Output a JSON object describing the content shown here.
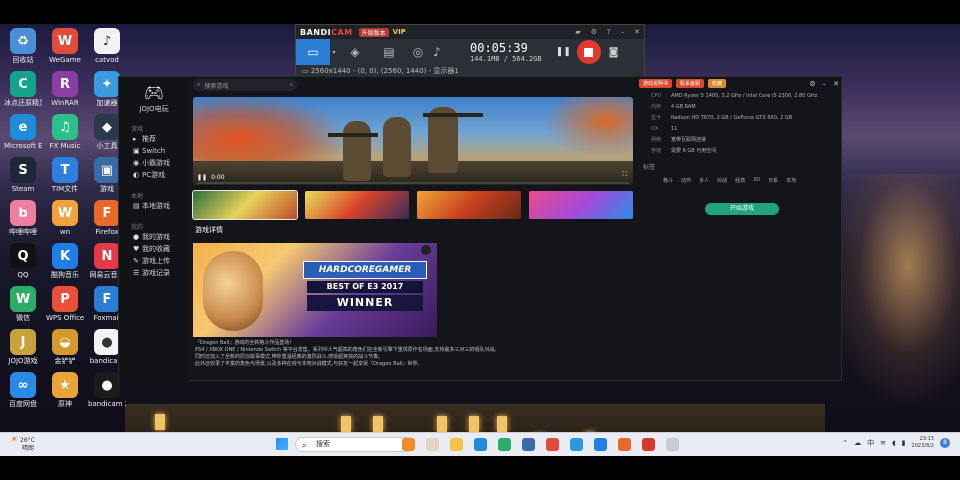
{
  "desktop": {
    "icons": [
      {
        "label": "回收站",
        "color": "#4b8fd8",
        "glyph": "♻"
      },
      {
        "label": "WeGame",
        "color": "#e24b3a",
        "glyph": "W"
      },
      {
        "label": "catvod",
        "color": "#f2f2f2",
        "glyph": "♪"
      },
      {
        "label": "冰点还原精灵",
        "color": "#13a58b",
        "glyph": "C"
      },
      {
        "label": "WinRAR",
        "color": "#8a3fa0",
        "glyph": "R"
      },
      {
        "label": "加速器",
        "color": "#3a9be0",
        "glyph": "✦"
      },
      {
        "label": "Microsoft Edge",
        "color": "#1e8cd8",
        "glyph": "e"
      },
      {
        "label": "FX Music",
        "color": "#2bbf8a",
        "glyph": "♫"
      },
      {
        "label": "小工具",
        "color": "#2a3a4a",
        "glyph": "◆"
      },
      {
        "label": "Steam",
        "color": "#1b2838",
        "glyph": "S"
      },
      {
        "label": "TIM文件",
        "color": "#2e7fe0",
        "glyph": "T"
      },
      {
        "label": "游戏",
        "color": "#3a6aa8",
        "glyph": "▣"
      },
      {
        "label": "哔哩哔哩",
        "color": "#f07ca2",
        "glyph": "b"
      },
      {
        "label": "wn",
        "color": "#f2a23a",
        "glyph": "W"
      },
      {
        "label": "Firefox",
        "color": "#e86a2a",
        "glyph": "F"
      },
      {
        "label": "QQ",
        "color": "#111111",
        "glyph": "Q"
      },
      {
        "label": "酷狗音乐",
        "color": "#1f7ee8",
        "glyph": "K"
      },
      {
        "label": "网易云音乐",
        "color": "#e43a4a",
        "glyph": "N"
      },
      {
        "label": "微信",
        "color": "#2aae67",
        "glyph": "W"
      },
      {
        "label": "WPS Office",
        "color": "#e8503a",
        "glyph": "P"
      },
      {
        "label": "Foxmail",
        "color": "#2a7fd4",
        "glyph": "F"
      },
      {
        "label": "JOJO游戏",
        "color": "#c8a23a",
        "glyph": "J"
      },
      {
        "label": "金铲铲",
        "color": "#d49a2a",
        "glyph": "◒"
      },
      {
        "label": "bandicam",
        "color": "#f2f2f2",
        "glyph": "●"
      },
      {
        "label": "百度网盘",
        "color": "#2a8ae8",
        "glyph": "∞"
      },
      {
        "label": "原神",
        "color": "#e8a33a",
        "glyph": "★"
      },
      {
        "label": "bandicam 2023 08",
        "color": "#1b1b1b",
        "glyph": "●"
      }
    ]
  },
  "bandicam": {
    "logo_a": "BANDI",
    "logo_b": "CAM",
    "chip": "升级版本",
    "vip": "VIP",
    "timer": "00:05:39",
    "size": "144.1MB / 564.2GB",
    "resolution": "2560x1440 - (0, 0), (2560, 1440) - 显示器1"
  },
  "app": {
    "sidebar": {
      "name": "JOJO电玩",
      "sections": [
        {
          "title": "游戏",
          "items": [
            {
              "icon": "▸",
              "label": "推荐"
            },
            {
              "icon": "▣",
              "label": "Switch"
            },
            {
              "icon": "◉",
              "label": "小霸游戏"
            },
            {
              "icon": "◐",
              "label": "PC游戏"
            }
          ]
        },
        {
          "title": "本地",
          "items": [
            {
              "icon": "▤",
              "label": "本地游戏"
            }
          ]
        },
        {
          "title": "我的",
          "items": [
            {
              "icon": "●",
              "label": "我的游戏"
            },
            {
              "icon": "♥",
              "label": "我的收藏"
            },
            {
              "icon": "✎",
              "label": "游戏上传"
            },
            {
              "icon": "☰",
              "label": "游戏记录"
            }
          ]
        }
      ]
    },
    "search": {
      "placeholder": "搜索游戏"
    },
    "hero": {
      "time": "0:00"
    },
    "section_title": "游戏详情",
    "cover": {
      "badge": "HARDCOREGAMER",
      "best": "BEST OF E3 2017",
      "winner": "WINNER"
    },
    "description": [
      "『Dragon Ball』游戏的全新格斗作品登场!",
      "PS4 / XBOX ONE / Nintendo Switch 等平台发售。系列中人气超高的角色们在全新引擎下重现原作名场面,支持最多三对三的组队对战。",
      "同时还加入了全新的原创故事模式,带你重温经典的激烈战斗,感受超爽快的战斗节奏。",
      "此外还收录了丰富的角色与场景,以及多种在线与本地对战模式,与好友一起享受『Dragon Ball』世界。"
    ],
    "right": {
      "buttons": [
        "游戏说明书",
        "联系客服",
        "收藏"
      ],
      "specs": [
        {
          "k": "CPU",
          "v": "AMD Ryzen 5 1400, 3.2 GHz / Intel Core i5-2300, 2.80 GHz"
        },
        {
          "k": "内存",
          "v": "4 GB RAM"
        },
        {
          "k": "显卡",
          "v": "Radeon HD 7870, 2 GB / GeForce GTX 660, 2 GB"
        },
        {
          "k": "DX",
          "v": "11"
        },
        {
          "k": "网络",
          "v": "宽带互联网连接"
        },
        {
          "k": "存储",
          "v": "需要 6 GB 可用空间"
        }
      ],
      "tags_title": "标签",
      "tags": [
        "格斗",
        "动作",
        "多人",
        "对战",
        "经典",
        "3D",
        "日系",
        "本地"
      ],
      "cta": "开始游戏"
    }
  },
  "taskbar": {
    "temp": "26°C",
    "weather": "晴朗",
    "search_placeholder": "搜索",
    "tray_lang": "中",
    "clock_time": "23:13",
    "clock_date": "2023/8/2",
    "badge": "8"
  }
}
